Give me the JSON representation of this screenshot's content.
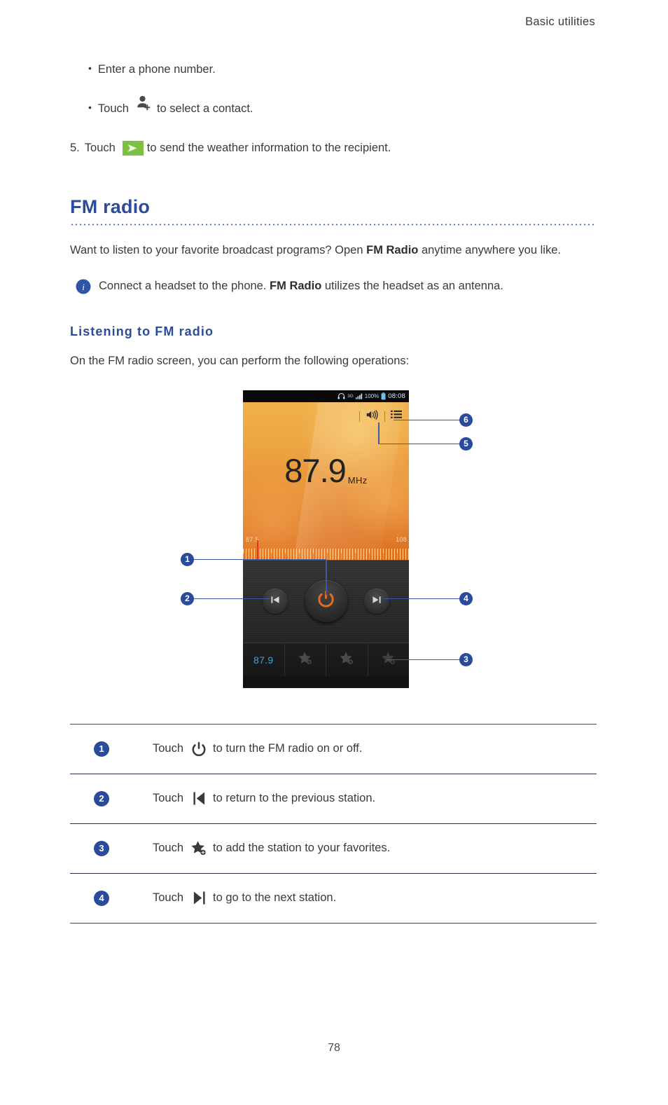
{
  "header": {
    "running_title": "Basic utilities"
  },
  "intro": {
    "bullets": [
      {
        "text": "Enter a phone number."
      },
      {
        "pre": "Touch",
        "icon": "add-contact-icon",
        "post": "to select a contact."
      }
    ],
    "step": {
      "number": "5.",
      "pre": "Touch",
      "icon": "send-icon",
      "post": "to send the weather information to the recipient."
    }
  },
  "section": {
    "title": "FM radio",
    "paragraph_part1": "Want to listen to your favorite broadcast programs? Open ",
    "paragraph_bold1": "FM Radio",
    "paragraph_part2": " anytime anywhere you like.",
    "note": {
      "icon": "info-icon",
      "part1": "Connect a headset to the phone. ",
      "bold1": "FM Radio",
      "part2": " utilizes the headset as an antenna."
    },
    "subtitle": "Listening to FM radio",
    "sub_paragraph": "On the FM radio screen, you can perform the following operations:"
  },
  "figure": {
    "statusbar": {
      "headset_icon": "headset-icon",
      "network_label": "3G",
      "signal_icon": "signal-bars-icon",
      "battery_pct": "100%",
      "battery_icon": "battery-icon",
      "clock": "08:08"
    },
    "screen": {
      "frequency": "87.9",
      "unit": "MHz",
      "speaker_icon": "speaker-icon",
      "list_icon": "station-list-icon",
      "tuner_min": "87.5",
      "tuner_max": "108"
    },
    "controls": {
      "prev_icon": "previous-station-icon",
      "power_icon": "power-icon",
      "next_icon": "next-station-icon"
    },
    "favorites": {
      "current": "87.9",
      "slots": [
        "add-favorite-icon",
        "add-favorite-icon",
        "add-favorite-icon"
      ]
    },
    "callouts": [
      {
        "num": "1"
      },
      {
        "num": "2"
      },
      {
        "num": "3"
      },
      {
        "num": "4"
      },
      {
        "num": "5"
      },
      {
        "num": "6"
      }
    ]
  },
  "legend": {
    "rows": [
      {
        "num": "1",
        "pre": "Touch",
        "icon": "power-icon",
        "post": "to turn the FM radio on or off."
      },
      {
        "num": "2",
        "pre": "Touch",
        "icon": "previous-station-icon",
        "post": "to return to the previous station."
      },
      {
        "num": "3",
        "pre": "Touch",
        "icon": "add-favorite-icon",
        "post": "to add the station to your favorites."
      },
      {
        "num": "4",
        "pre": "Touch",
        "icon": "next-station-icon",
        "post": "to go to the next station."
      }
    ]
  },
  "footer": {
    "page_number": "78"
  },
  "colors": {
    "heading_blue": "#2C4B9B",
    "callout_blue": "#2A4A9B",
    "send_green": "#7CC242",
    "accent_orange": "#E8761F",
    "needle_red": "#E8312A",
    "favorite_cyan": "#4A9FD4"
  }
}
